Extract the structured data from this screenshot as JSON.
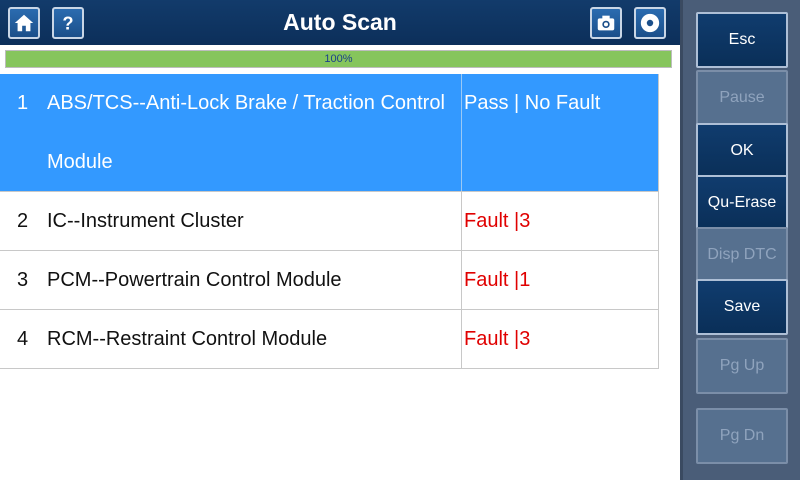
{
  "header": {
    "title": "Auto Scan",
    "home_icon": "home-icon",
    "help_icon": "help-icon",
    "camera_icon": "camera-icon",
    "disc_icon": "disc-icon"
  },
  "progress": {
    "label": "100%",
    "fraction": 1.0
  },
  "modules": [
    {
      "num": "1",
      "name": "ABS/TCS--Anti-Lock Brake / Traction Control Module",
      "status": "Pass | No Fault",
      "selected": true
    },
    {
      "num": "2",
      "name": "IC--Instrument Cluster",
      "status": "Fault |3",
      "selected": false
    },
    {
      "num": "3",
      "name": "PCM--Powertrain Control Module",
      "status": "Fault |1",
      "selected": false
    },
    {
      "num": "4",
      "name": "RCM--Restraint Control Module",
      "status": "Fault |3",
      "selected": false
    }
  ],
  "side_buttons": [
    {
      "label": "Esc",
      "enabled": true
    },
    {
      "label": "Pause",
      "enabled": false
    },
    {
      "label": "OK",
      "enabled": true
    },
    {
      "label": "Qu-Erase",
      "enabled": true
    },
    {
      "label": "Disp DTC",
      "enabled": false
    },
    {
      "label": "Save",
      "enabled": true
    },
    {
      "label": "Pg Up",
      "enabled": false
    },
    {
      "label": "Pg Dn",
      "enabled": false
    }
  ],
  "colors": {
    "header_bg": "#0c2f5a",
    "selected_row": "#3399ff",
    "fault_text": "#e00000",
    "progress_fill": "#86c55c",
    "side_panel": "#4a5d78"
  }
}
